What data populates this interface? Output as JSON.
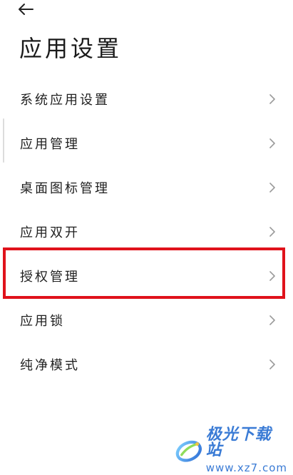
{
  "header": {
    "back_icon": "arrow-left-icon",
    "title": "应用设置"
  },
  "menu": {
    "items": [
      {
        "label": "系统应用设置",
        "icon": "chevron-right-icon"
      },
      {
        "label": "应用管理",
        "icon": "chevron-right-icon"
      },
      {
        "label": "桌面图标管理",
        "icon": "chevron-right-icon"
      },
      {
        "label": "应用双开",
        "icon": "chevron-right-icon"
      },
      {
        "label": "授权管理",
        "icon": "chevron-right-icon",
        "highlighted": true
      },
      {
        "label": "应用锁",
        "icon": "chevron-right-icon"
      },
      {
        "label": "纯净模式",
        "icon": "chevron-right-icon"
      }
    ]
  },
  "highlight": {
    "color": "#e0121b",
    "target": "授权管理"
  },
  "watermark": {
    "name": "极光下载站",
    "url": "www.xz7.com",
    "color": "#3a7bd5"
  }
}
